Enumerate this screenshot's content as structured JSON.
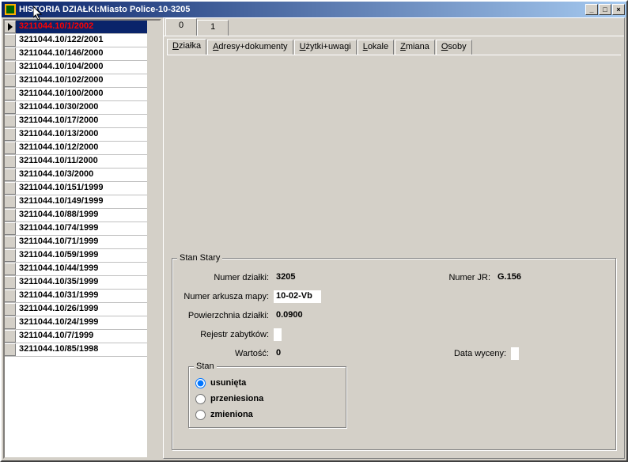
{
  "window": {
    "title": "HISTORIA DZIAŁKI:Miasto Police-10-3205"
  },
  "grid": {
    "rows": [
      "3211044.10/1/2002",
      "3211044.10/122/2001",
      "3211044.10/146/2000",
      "3211044.10/104/2000",
      "3211044.10/102/2000",
      "3211044.10/100/2000",
      "3211044.10/30/2000",
      "3211044.10/17/2000",
      "3211044.10/13/2000",
      "3211044.10/12/2000",
      "3211044.10/11/2000",
      "3211044.10/3/2000",
      "3211044.10/151/1999",
      "3211044.10/149/1999",
      "3211044.10/88/1999",
      "3211044.10/74/1999",
      "3211044.10/71/1999",
      "3211044.10/59/1999",
      "3211044.10/44/1999",
      "3211044.10/35/1999",
      "3211044.10/31/1999",
      "3211044.10/26/1999",
      "3211044.10/24/1999",
      "3211044.10/7/1999",
      "3211044.10/85/1998"
    ],
    "selected_index": 0
  },
  "outerTabs": [
    "0",
    "1"
  ],
  "outerTabActive": 0,
  "innerTabs": {
    "items": [
      {
        "label": "Działka"
      },
      {
        "label": "Adresy+dokumenty"
      },
      {
        "label": "Użytki+uwagi"
      },
      {
        "label": "Lokale"
      },
      {
        "label": "Zmiana"
      },
      {
        "label": "Osoby"
      }
    ],
    "active": 0
  },
  "stanStary": {
    "title": "Stan Stary",
    "labels": {
      "numer_dzialki": "Numer działki:",
      "numer_jr": "Numer JR:",
      "numer_arkusza": "Numer arkusza mapy:",
      "powierzchnia": "Powierzchnia działki:",
      "rejestr": "Rejestr zabytków:",
      "wartosc": "Wartość:",
      "data_wyceny": "Data wyceny:"
    },
    "values": {
      "numer_dzialki": "3205",
      "numer_jr": "G.156",
      "numer_arkusza": "10-02-Vb",
      "powierzchnia": "0.0900",
      "rejestr": "",
      "wartosc": "0",
      "data_wyceny": ""
    }
  },
  "stan": {
    "title": "Stan",
    "options": [
      "usunięta",
      "przeniesiona",
      "zmieniona"
    ],
    "selected": 0
  }
}
